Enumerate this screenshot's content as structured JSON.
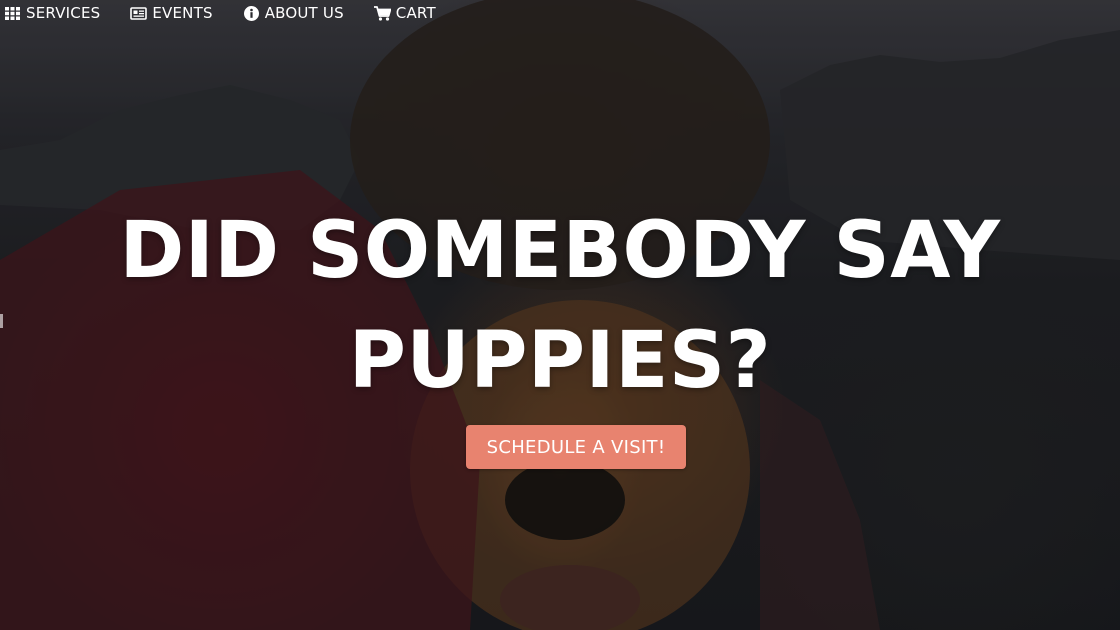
{
  "nav": {
    "items": [
      {
        "label": "SERVICES",
        "icon": "grid-icon"
      },
      {
        "label": "EVENTS",
        "icon": "newspaper-icon"
      },
      {
        "label": "ABOUT US",
        "icon": "info-icon"
      },
      {
        "label": "CART",
        "icon": "cart-icon"
      }
    ]
  },
  "hero": {
    "headline_line1": "DID SOMEBODY SAY",
    "headline_line2": "PUPPIES?",
    "cta_label": "SCHEDULE A VISIT!"
  },
  "colors": {
    "accent": "#e8836f",
    "text": "#ffffff",
    "background": "#1b1b20"
  }
}
